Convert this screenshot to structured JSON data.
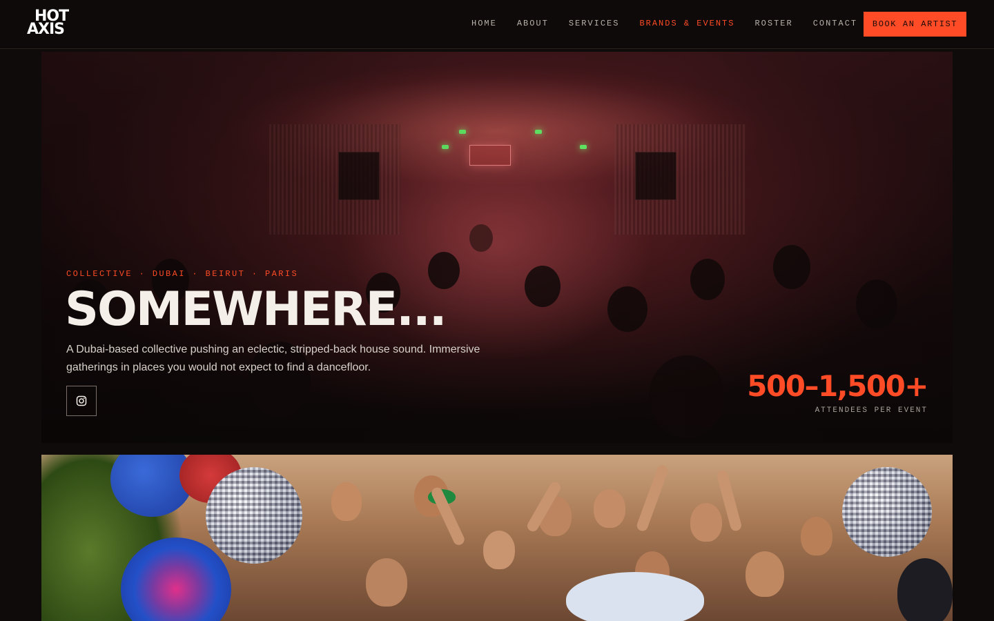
{
  "brand": {
    "logo_line1": "HOT",
    "logo_line2": "AXIS"
  },
  "nav": {
    "links": [
      {
        "label": "HOME",
        "active": false
      },
      {
        "label": "ABOUT",
        "active": false
      },
      {
        "label": "SERVICES",
        "active": false
      },
      {
        "label": "BRANDS & EVENTS",
        "active": true
      },
      {
        "label": "ROSTER",
        "active": false
      },
      {
        "label": "CONTACT",
        "active": false
      }
    ],
    "cta_label": "BOOK AN ARTIST"
  },
  "hero": {
    "eyebrow": "COLLECTIVE · DUBAI · BEIRUT · PARIS",
    "title": "SOMEWHERE...",
    "description": "A Dubai-based collective pushing an eclectic, stripped-back house sound. Immersive gatherings in places you would not expect to find a dancefloor.",
    "social_icon": "instagram-icon",
    "stat_value": "500–1,500+",
    "stat_label": "ATTENDEES PER EVENT"
  },
  "colors": {
    "accent": "#ff4b26",
    "background": "#0f0b0a",
    "text": "#f4efe8"
  }
}
